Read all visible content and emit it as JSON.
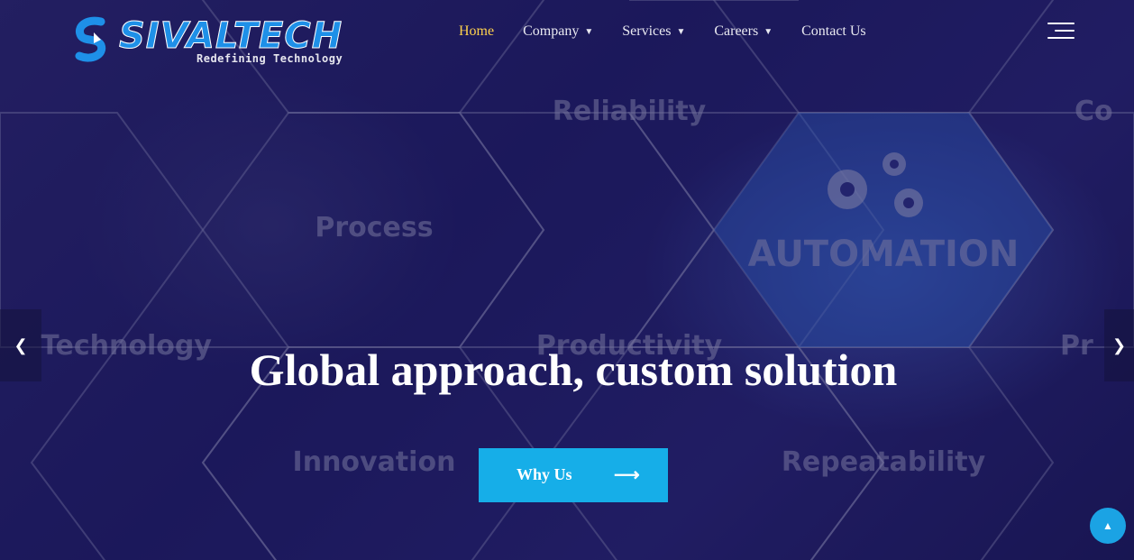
{
  "brand": {
    "name": "SIVALTECH",
    "tagline": "Redefining Technology",
    "color": "#1e90e8"
  },
  "nav": {
    "items": [
      {
        "label": "Home",
        "has_dropdown": false,
        "active": true
      },
      {
        "label": "Company",
        "has_dropdown": true,
        "active": false
      },
      {
        "label": "Services",
        "has_dropdown": true,
        "active": false
      },
      {
        "label": "Careers",
        "has_dropdown": true,
        "active": false
      },
      {
        "label": "Contact Us",
        "has_dropdown": false,
        "active": false
      }
    ],
    "active_color": "#ffd24d",
    "menu_icon": "hamburger-icon"
  },
  "hero": {
    "background_words": [
      "Reliability",
      "Process",
      "AUTOMATION",
      "Technology",
      "Productivity",
      "Innovation",
      "Repeatability",
      "Co",
      "Pr"
    ],
    "headline": "Global approach, custom solution",
    "cta_label": "Why Us",
    "cta_icon": "arrow-right-icon",
    "cta_color": "#16aee8"
  },
  "controls": {
    "prev_icon": "chevron-left-icon",
    "next_icon": "chevron-right-icon",
    "scroll_top_icon": "chevron-up-icon"
  }
}
